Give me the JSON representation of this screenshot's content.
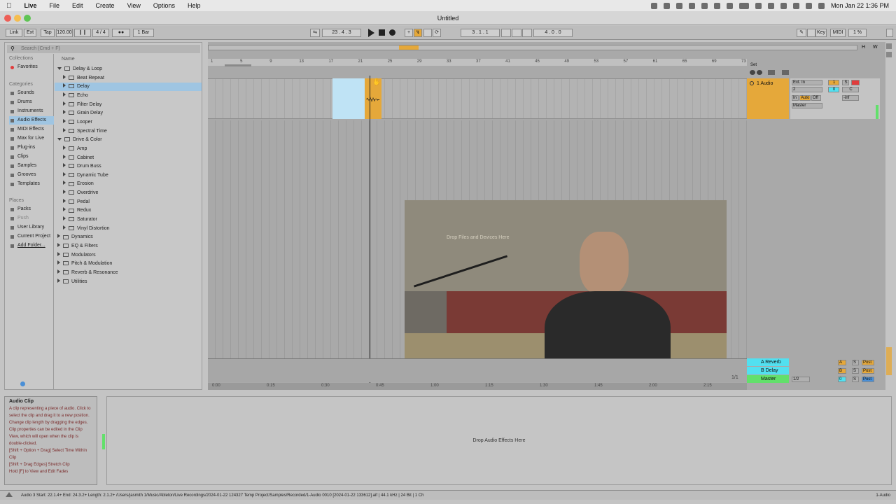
{
  "menubar": {
    "apple": "",
    "items": [
      "Live",
      "File",
      "Edit",
      "Create",
      "View",
      "Options",
      "Help"
    ],
    "clock": "Mon Jan 22  1:36 PM"
  },
  "window": {
    "title": "Untitled"
  },
  "control_bar": {
    "link": "Link",
    "ext": "Ext",
    "tap": "Tap",
    "tempo": "120.00",
    "time_signature": "4 / 4",
    "quantize": "1 Bar",
    "position": "23 .   4 .   3",
    "loop_start": "3 .   1 .   1",
    "loop_length": "4 .   0 .   0",
    "key": "Key",
    "midi": "MIDI",
    "cpu": "1 %"
  },
  "browser": {
    "search_placeholder": "Search (Cmd + F)",
    "collections_header": "Collections",
    "favorites": "Favorites",
    "categories_header": "Categories",
    "categories": [
      "Sounds",
      "Drums",
      "Instruments",
      "Audio Effects",
      "MIDI Effects",
      "Max for Live",
      "Plug-ins",
      "Clips",
      "Samples",
      "Grooves",
      "Templates"
    ],
    "places_header": "Places",
    "places": [
      "Packs",
      "Push",
      "User Library",
      "Current Project",
      "Add Folder..."
    ],
    "name_header": "Name",
    "items": [
      {
        "label": "Delay & Loop",
        "level": 0,
        "open": true
      },
      {
        "label": "Beat Repeat",
        "level": 1
      },
      {
        "label": "Delay",
        "level": 1,
        "selected": true
      },
      {
        "label": "Echo",
        "level": 1
      },
      {
        "label": "Filter Delay",
        "level": 1
      },
      {
        "label": "Grain Delay",
        "level": 1
      },
      {
        "label": "Looper",
        "level": 1
      },
      {
        "label": "Spectral Time",
        "level": 1
      },
      {
        "label": "Drive & Color",
        "level": 0,
        "open": true
      },
      {
        "label": "Amp",
        "level": 1
      },
      {
        "label": "Cabinet",
        "level": 1
      },
      {
        "label": "Drum Buss",
        "level": 1
      },
      {
        "label": "Dynamic Tube",
        "level": 1
      },
      {
        "label": "Erosion",
        "level": 1
      },
      {
        "label": "Overdrive",
        "level": 1
      },
      {
        "label": "Pedal",
        "level": 1
      },
      {
        "label": "Redux",
        "level": 1
      },
      {
        "label": "Saturator",
        "level": 1
      },
      {
        "label": "Vinyl Distortion",
        "level": 1
      },
      {
        "label": "Dynamics",
        "level": 0
      },
      {
        "label": "EQ & Filters",
        "level": 0
      },
      {
        "label": "Modulators",
        "level": 0
      },
      {
        "label": "Pitch & Modulation",
        "level": 0
      },
      {
        "label": "Reverb & Resonance",
        "level": 0
      },
      {
        "label": "Utilities",
        "level": 0
      }
    ]
  },
  "arrangement": {
    "ruler_bars": [
      "1",
      "5",
      "9",
      "13",
      "17",
      "21",
      "25",
      "29",
      "33",
      "37",
      "41",
      "45",
      "49",
      "53",
      "57",
      "61",
      "65",
      "69",
      "73"
    ],
    "time_ticks": [
      "0:00",
      "0:15",
      "0:30",
      "0:45",
      "1:00",
      "1:15",
      "1:30",
      "1:45",
      "2:00",
      "2:15"
    ],
    "drop_hint": "Drop Files and Devices Here",
    "page_indicator": "1/1",
    "set_label": "Set"
  },
  "track": {
    "name": "1 Audio",
    "input_type": "Ext. In",
    "input_channel": "2",
    "monitor": [
      "In",
      "Auto",
      "Off"
    ],
    "output": "Master",
    "activator": "1",
    "volume": "0",
    "pan": "C",
    "solo": "S",
    "meter_db": "-inf"
  },
  "returns": [
    {
      "name": "A Reverb",
      "letter": "A",
      "solo": "S",
      "post": "Post"
    },
    {
      "name": "B Delay",
      "letter": "B",
      "solo": "S",
      "post": "Post"
    }
  ],
  "master": {
    "name": "Master",
    "tempo_div": "1/2",
    "volume": "0",
    "solo": "S",
    "post": "Post"
  },
  "info_view": {
    "title": "Audio Clip",
    "text": "A clip representing a piece of audio. Click to select the clip and drag it to a new position. Change clip length by dragging the edges. Clip properties can be edited in the Clip View, which will open when the clip is double-clicked.",
    "shortcuts": [
      "[Shift + Option + Drag] Select Time Within Clip",
      "[Shift + Drag Edges] Stretch Clip",
      "Hold [F] to View and Edit Fades"
    ]
  },
  "detail": {
    "drop_hint": "Drop Audio Effects Here"
  },
  "status": {
    "text": "Audio 3  Start: 22.1.4+  End: 24.3.2+  Length: 2.1.2+  /Users/jasmith 1/Music/Ableton/Live Recordings/2024-01-22 124327 Temp Project/Samples/Recorded/1-Audio 0010 [2024-01-22 133612].aif  |  44.1 kHz  |  24 Bit  |  1 Ch",
    "track_name": "1-Audio"
  },
  "colors": {
    "clip_loop": "#bfe3f5",
    "clip_audio": "#e5a83a",
    "selection": "#9fc5e2",
    "record_red": "#e03c3c",
    "return_cyan": "#52e0f0",
    "master_green": "#62e06b",
    "link_red": "#d94b4b"
  }
}
